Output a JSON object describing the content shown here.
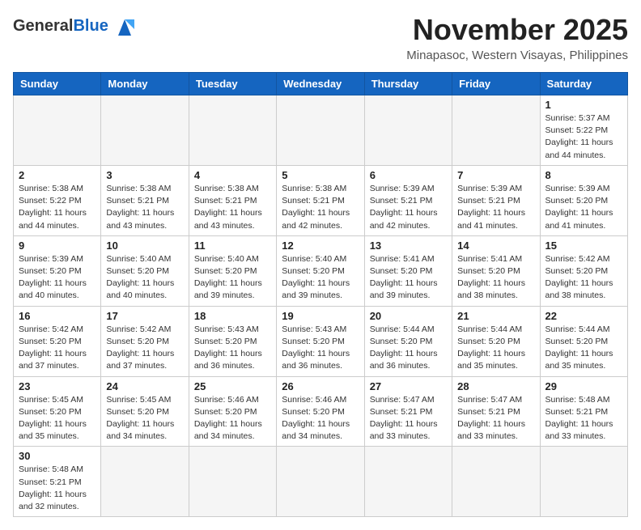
{
  "header": {
    "logo_general": "General",
    "logo_blue": "Blue",
    "month_title": "November 2025",
    "location": "Minapasoc, Western Visayas, Philippines"
  },
  "days_of_week": [
    "Sunday",
    "Monday",
    "Tuesday",
    "Wednesday",
    "Thursday",
    "Friday",
    "Saturday"
  ],
  "weeks": [
    [
      {
        "date": "",
        "info": ""
      },
      {
        "date": "",
        "info": ""
      },
      {
        "date": "",
        "info": ""
      },
      {
        "date": "",
        "info": ""
      },
      {
        "date": "",
        "info": ""
      },
      {
        "date": "",
        "info": ""
      },
      {
        "date": "1",
        "info": "Sunrise: 5:37 AM\nSunset: 5:22 PM\nDaylight: 11 hours\nand 44 minutes."
      }
    ],
    [
      {
        "date": "2",
        "info": "Sunrise: 5:38 AM\nSunset: 5:22 PM\nDaylight: 11 hours\nand 44 minutes."
      },
      {
        "date": "3",
        "info": "Sunrise: 5:38 AM\nSunset: 5:21 PM\nDaylight: 11 hours\nand 43 minutes."
      },
      {
        "date": "4",
        "info": "Sunrise: 5:38 AM\nSunset: 5:21 PM\nDaylight: 11 hours\nand 43 minutes."
      },
      {
        "date": "5",
        "info": "Sunrise: 5:38 AM\nSunset: 5:21 PM\nDaylight: 11 hours\nand 42 minutes."
      },
      {
        "date": "6",
        "info": "Sunrise: 5:39 AM\nSunset: 5:21 PM\nDaylight: 11 hours\nand 42 minutes."
      },
      {
        "date": "7",
        "info": "Sunrise: 5:39 AM\nSunset: 5:21 PM\nDaylight: 11 hours\nand 41 minutes."
      },
      {
        "date": "8",
        "info": "Sunrise: 5:39 AM\nSunset: 5:20 PM\nDaylight: 11 hours\nand 41 minutes."
      }
    ],
    [
      {
        "date": "9",
        "info": "Sunrise: 5:39 AM\nSunset: 5:20 PM\nDaylight: 11 hours\nand 40 minutes."
      },
      {
        "date": "10",
        "info": "Sunrise: 5:40 AM\nSunset: 5:20 PM\nDaylight: 11 hours\nand 40 minutes."
      },
      {
        "date": "11",
        "info": "Sunrise: 5:40 AM\nSunset: 5:20 PM\nDaylight: 11 hours\nand 39 minutes."
      },
      {
        "date": "12",
        "info": "Sunrise: 5:40 AM\nSunset: 5:20 PM\nDaylight: 11 hours\nand 39 minutes."
      },
      {
        "date": "13",
        "info": "Sunrise: 5:41 AM\nSunset: 5:20 PM\nDaylight: 11 hours\nand 39 minutes."
      },
      {
        "date": "14",
        "info": "Sunrise: 5:41 AM\nSunset: 5:20 PM\nDaylight: 11 hours\nand 38 minutes."
      },
      {
        "date": "15",
        "info": "Sunrise: 5:42 AM\nSunset: 5:20 PM\nDaylight: 11 hours\nand 38 minutes."
      }
    ],
    [
      {
        "date": "16",
        "info": "Sunrise: 5:42 AM\nSunset: 5:20 PM\nDaylight: 11 hours\nand 37 minutes."
      },
      {
        "date": "17",
        "info": "Sunrise: 5:42 AM\nSunset: 5:20 PM\nDaylight: 11 hours\nand 37 minutes."
      },
      {
        "date": "18",
        "info": "Sunrise: 5:43 AM\nSunset: 5:20 PM\nDaylight: 11 hours\nand 36 minutes."
      },
      {
        "date": "19",
        "info": "Sunrise: 5:43 AM\nSunset: 5:20 PM\nDaylight: 11 hours\nand 36 minutes."
      },
      {
        "date": "20",
        "info": "Sunrise: 5:44 AM\nSunset: 5:20 PM\nDaylight: 11 hours\nand 36 minutes."
      },
      {
        "date": "21",
        "info": "Sunrise: 5:44 AM\nSunset: 5:20 PM\nDaylight: 11 hours\nand 35 minutes."
      },
      {
        "date": "22",
        "info": "Sunrise: 5:44 AM\nSunset: 5:20 PM\nDaylight: 11 hours\nand 35 minutes."
      }
    ],
    [
      {
        "date": "23",
        "info": "Sunrise: 5:45 AM\nSunset: 5:20 PM\nDaylight: 11 hours\nand 35 minutes."
      },
      {
        "date": "24",
        "info": "Sunrise: 5:45 AM\nSunset: 5:20 PM\nDaylight: 11 hours\nand 34 minutes."
      },
      {
        "date": "25",
        "info": "Sunrise: 5:46 AM\nSunset: 5:20 PM\nDaylight: 11 hours\nand 34 minutes."
      },
      {
        "date": "26",
        "info": "Sunrise: 5:46 AM\nSunset: 5:20 PM\nDaylight: 11 hours\nand 34 minutes."
      },
      {
        "date": "27",
        "info": "Sunrise: 5:47 AM\nSunset: 5:21 PM\nDaylight: 11 hours\nand 33 minutes."
      },
      {
        "date": "28",
        "info": "Sunrise: 5:47 AM\nSunset: 5:21 PM\nDaylight: 11 hours\nand 33 minutes."
      },
      {
        "date": "29",
        "info": "Sunrise: 5:48 AM\nSunset: 5:21 PM\nDaylight: 11 hours\nand 33 minutes."
      }
    ],
    [
      {
        "date": "30",
        "info": "Sunrise: 5:48 AM\nSunset: 5:21 PM\nDaylight: 11 hours\nand 32 minutes."
      },
      {
        "date": "",
        "info": ""
      },
      {
        "date": "",
        "info": ""
      },
      {
        "date": "",
        "info": ""
      },
      {
        "date": "",
        "info": ""
      },
      {
        "date": "",
        "info": ""
      },
      {
        "date": "",
        "info": ""
      }
    ]
  ]
}
